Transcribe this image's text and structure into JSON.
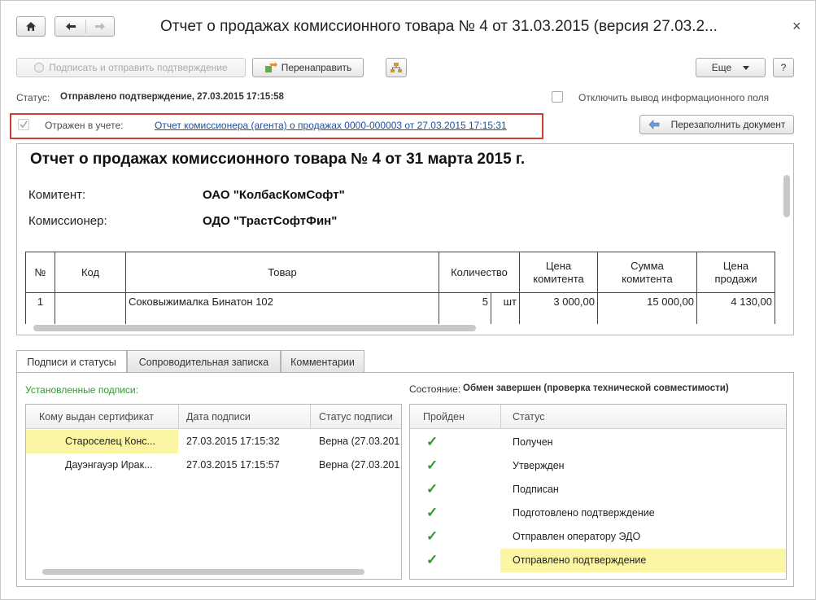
{
  "window": {
    "title": "Отчет о продажах комиссионного товара № 4 от 31.03.2015 (версия 27.03.2...",
    "close_glyph": "×"
  },
  "toolbar": {
    "sign_send_label": "Подписать и отправить подтверждение",
    "redirect_label": "Перенаправить",
    "more_label": "Еще",
    "help_label": "?"
  },
  "status": {
    "label": "Статус:",
    "value": "Отправлено подтверждение, 27.03.2015 17:15:58",
    "disable_info_label": "Отключить вывод информационного поля"
  },
  "reflected": {
    "label": "Отражен в учете:",
    "link": "Отчет комиссионера (агента) о продажах 0000-000003 от 27.03.2015 17:15:31",
    "refill_label": "Перезаполнить документ"
  },
  "document": {
    "heading": "Отчет о продажах комиссионного товара № 4 от 31 марта 2015 г.",
    "committent_label": "Комитент:",
    "committent_value": "ОАО \"КолбасКомСофт\"",
    "commissioner_label": "Комиссионер:",
    "commissioner_value": "ОДО \"ТрастСофтФин\"",
    "columns": {
      "num": "№",
      "code": "Код",
      "goods": "Товар",
      "qty": "Количество",
      "price_line1": "Цена",
      "price_line2": "комитента",
      "sum_line1": "Сумма",
      "sum_line2": "комитента",
      "sale_line1": "Цена",
      "sale_line2": "продажи"
    },
    "row": {
      "num": "1",
      "code": "",
      "goods": "Соковыжималка Бинатон 102",
      "qty": "5",
      "unit": "шт",
      "price": "3 000,00",
      "sum": "15 000,00",
      "sale": "4 130,00"
    }
  },
  "tabs": [
    {
      "label": "Подписи и статусы"
    },
    {
      "label": "Сопроводительная записка"
    },
    {
      "label": "Комментарии"
    }
  ],
  "signatures": {
    "title": "Установленные подписи:",
    "headers": [
      "Кому выдан сертификат",
      "Дата подписи",
      "Статус подписи"
    ],
    "rows": [
      {
        "who": "Староселец Конс...",
        "date": "27.03.2015 17:15:32",
        "status": "Верна (27.03.201"
      },
      {
        "who": "Дауэнгауэр Ирак...",
        "date": "27.03.2015 17:15:57",
        "status": "Верна (27.03.201"
      }
    ]
  },
  "state": {
    "label": "Состояние:",
    "value": "Обмен завершен (проверка технической совместимости)",
    "headers": [
      "Пройден",
      "Статус"
    ],
    "check_glyph": "✓",
    "rows": [
      {
        "status": "Получен"
      },
      {
        "status": "Утвержден"
      },
      {
        "status": "Подписан"
      },
      {
        "status": "Подготовлено подтверждение"
      },
      {
        "status": "Отправлен оператору ЭДО"
      },
      {
        "status": "Отправлено подтверждение"
      }
    ]
  },
  "colors": {
    "highlight": "#fbf6a4",
    "link": "#1f4ea0",
    "green_title": "#2f9a2f",
    "red_frame": "#d33a3a"
  }
}
